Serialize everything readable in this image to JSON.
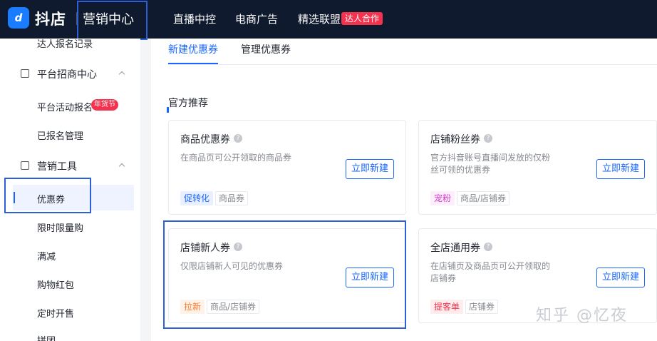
{
  "topbar": {
    "brand": "抖店",
    "portal": "营销中心",
    "nav": [
      "直播中控",
      "电商广告",
      "精选联盟"
    ],
    "nav_badge": "达人合作"
  },
  "sidebar": {
    "top_item": "达人报名记录",
    "group1": {
      "label": "平台招商中心",
      "items": [
        "平台活动报名",
        "已报名管理"
      ],
      "badge": "年货节"
    },
    "group2": {
      "label": "营销工具",
      "items": [
        "优惠券",
        "限时限量购",
        "满减",
        "购物红包",
        "定时开售",
        "拼团"
      ]
    }
  },
  "main": {
    "tabs": [
      "新建优惠券",
      "管理优惠券"
    ],
    "section_title": "官方推荐",
    "cards": [
      {
        "title": "商品优惠券",
        "desc": "在商品页可公开领取的商品券",
        "button": "立即新建",
        "tags": [
          "促转化",
          "商品券"
        ]
      },
      {
        "title": "店铺粉丝券",
        "desc": "官方抖音账号直播间发放的仅粉丝可领的优惠券",
        "button": "立即新建",
        "tags": [
          "宠粉",
          "商品/店铺券"
        ]
      },
      {
        "title": "店铺新人券",
        "desc": "仅限店铺新人可见的优惠券",
        "button": "立即新建",
        "tags": [
          "拉新",
          "商品/店铺券"
        ]
      },
      {
        "title": "全店通用券",
        "desc": "在店铺页及商品页可公开领取的店铺券",
        "button": "立即新建",
        "tags": [
          "提客单",
          "店铺券"
        ]
      }
    ]
  },
  "watermark": "知乎 @忆夜",
  "colors": {
    "accent": "#1966ff",
    "topbar": "#0f1a2e",
    "highlight": "#2d5fd6",
    "badge": "#f5314e"
  }
}
